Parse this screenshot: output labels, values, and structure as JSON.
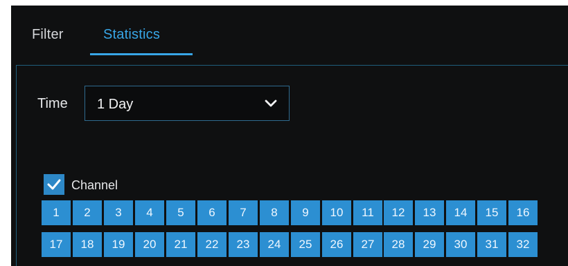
{
  "tabs": [
    {
      "label": "Filter",
      "active": false
    },
    {
      "label": "Statistics",
      "active": true
    }
  ],
  "time": {
    "label": "Time",
    "selected": "1 Day"
  },
  "channel": {
    "label": "Channel",
    "checked": true,
    "numbers": [
      "1",
      "2",
      "3",
      "4",
      "5",
      "6",
      "7",
      "8",
      "9",
      "10",
      "11",
      "12",
      "13",
      "14",
      "15",
      "16",
      "17",
      "18",
      "19",
      "20",
      "21",
      "22",
      "23",
      "24",
      "25",
      "26",
      "27",
      "28",
      "29",
      "30",
      "31",
      "32"
    ]
  },
  "colors": {
    "accent": "#38a6e7",
    "background": "#0f1011",
    "channel_cell": "#2c8fd2"
  },
  "icons": {
    "dropdown": "chevron-down-icon",
    "checkbox": "checkmark-icon"
  }
}
